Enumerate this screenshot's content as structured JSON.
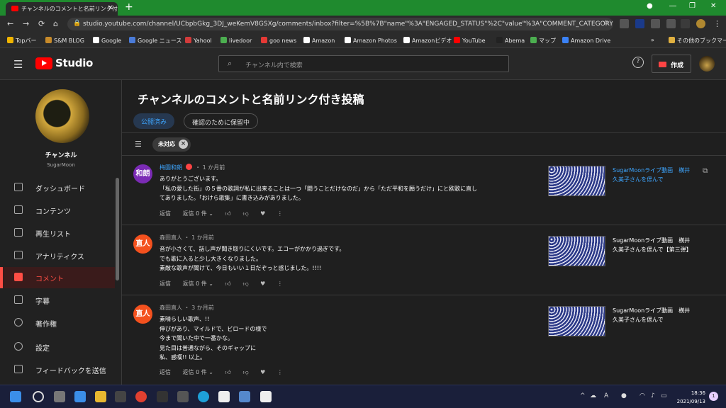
{
  "browser": {
    "tab_title": "チャンネルのコメントと名前リンク付き投稿",
    "tab_close": "✕",
    "new_tab": "+",
    "url": "studio.youtube.com/channel/UCbpbGkg_3DJ_weKemV8GSXg/comments/inbox?filter=%5B%7B\"name\"%3A\"ENGAGED_STATUS\"%2C\"value\"%3A\"COMMENT_CATEGORY_NOT_...",
    "bookmarks": [
      {
        "label": "Topバー",
        "color": "#f0b400"
      },
      {
        "label": "S&M BLOG",
        "color": "#c78a2a"
      },
      {
        "label": "Google",
        "color": "#ffffff"
      },
      {
        "label": "Google ニュース",
        "color": "#4a7bd8"
      },
      {
        "label": "Yahool",
        "color": "#d23b3b"
      },
      {
        "label": "livedoor",
        "color": "#4caf50"
      },
      {
        "label": "goo news",
        "color": "#e53935"
      },
      {
        "label": "Amazon",
        "color": "#ffffff"
      },
      {
        "label": "Amazon Photos",
        "color": "#ffffff"
      },
      {
        "label": "Amazonビデオ",
        "color": "#ffffff"
      },
      {
        "label": "YouTube",
        "color": "#ff0000"
      },
      {
        "label": "Abema",
        "color": "#222222"
      },
      {
        "label": "マップ",
        "color": "#4caf50"
      },
      {
        "label": "Amazon Drive",
        "color": "#3b82f6"
      }
    ],
    "bookmarks_more": "»",
    "other_bookmarks": "その他のブックマーク"
  },
  "header": {
    "studio_label": "Studio",
    "search_placeholder": "チャンネル内で検索",
    "help": "?",
    "create_label": "作成"
  },
  "channel": {
    "title": "チャンネル",
    "name": "SugarMoon"
  },
  "nav": [
    {
      "label": "ダッシュボード"
    },
    {
      "label": "コンテンツ"
    },
    {
      "label": "再生リスト"
    },
    {
      "label": "アナリティクス"
    },
    {
      "label": "コメント"
    },
    {
      "label": "字幕"
    },
    {
      "label": "著作権"
    },
    {
      "label": "設定"
    },
    {
      "label": "フィードバックを送信"
    }
  ],
  "page": {
    "title": "チャンネルのコメントと名前リンク付き投稿",
    "tab_published": "公開済み",
    "tab_held": "確認のために保留中",
    "filter_chip": "未対応"
  },
  "comments": [
    {
      "avatar_text": "和朗",
      "avatar_color": "#7b2bb5",
      "author": "梅園和朗",
      "time": "・ 1 か月前",
      "lines": [
        "ありがとうございます。",
        "「私の愛した街」の５番の歌詞が私に出来ることは一つ「闘うことだけなのだ」から「ただ平和を願うだけ」にと欧歌に直し",
        "てありました。「おけら歌集」に書き込みがありました。"
      ],
      "reply": "返信",
      "reply_count": "返信 0 件 ⌄",
      "video_title": "SugarMoonライブ動画　横井久美子さんを偲んで"
    },
    {
      "avatar_text": "直人",
      "avatar_color": "#f4511e",
      "author": "森田直人",
      "time": "・ 1 か月前",
      "lines": [
        "音が小さくて、話し声が聞き取りにくいです。エコーがかかり過ぎです。",
        "でも歌に入ると少し大きくなりました。",
        "素敵な歌声が聞けて、今日もいい１日だぞっと感じました。!!!!"
      ],
      "reply": "返信",
      "reply_count": "返信 0 件 ⌄",
      "video_title": "SugarMoonライブ動画　横井久美子さんを偲んで【第三弾】"
    },
    {
      "avatar_text": "直人",
      "avatar_color": "#f4511e",
      "author": "森田直人",
      "time": "・ 3 か月前",
      "lines": [
        "素晴らしい歌声、!!",
        "伸びがあり、マイルドで、ビロードの様で",
        "今まで聞いた中で一番かな。",
        "見た目は普通ながら、そのギャップに",
        "私、感嘆!! 以上。"
      ],
      "reply": "返信",
      "reply_count": "返信 0 件 ⌄",
      "video_title": "SugarMoonライブ動画　横井久美子さんを偲んで"
    }
  ],
  "taskbar": {
    "time": "18:36",
    "date": "2021/09/13",
    "ime": "A",
    "notif": "1"
  }
}
